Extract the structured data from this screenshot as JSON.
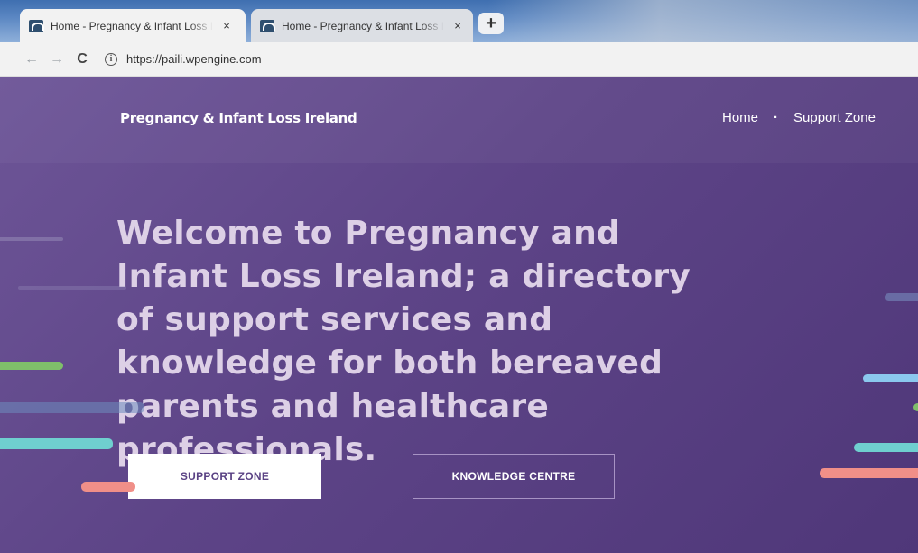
{
  "browser": {
    "tabs": [
      {
        "title": "Home - Pregnancy & Infant Loss Ireland",
        "close": "×",
        "active": true
      },
      {
        "title": "Home - Pregnancy & Infant Loss Ireland",
        "close": "×",
        "active": false
      }
    ],
    "new_tab": "+",
    "nav": {
      "back": "←",
      "forward": "→",
      "reload": "C"
    },
    "info": "i",
    "url": "https://paili.wpengine.com"
  },
  "site": {
    "brand": "Pregnancy & Infant Loss Ireland",
    "nav": [
      {
        "label": "Home"
      },
      {
        "label": "Support Zone"
      }
    ],
    "nav_separator": "·",
    "hero": {
      "headline": "Welcome to Pregnancy and Infant Loss Ireland; a directory of support services and knowledge for both bereaved parents and healthcare professionals.",
      "primary_button": "SUPPORT ZONE",
      "secondary_button": "KNOWLEDGE CENTRE"
    }
  },
  "colors": {
    "page_background": "#5d4487",
    "primary_button_text": "#5a4284",
    "headline": "#ddd0e6",
    "streak_green": "#7fbf6a",
    "streak_teal": "#6fcfcf",
    "streak_coral": "#f08f88",
    "streak_blue": "#8bc8ee"
  }
}
